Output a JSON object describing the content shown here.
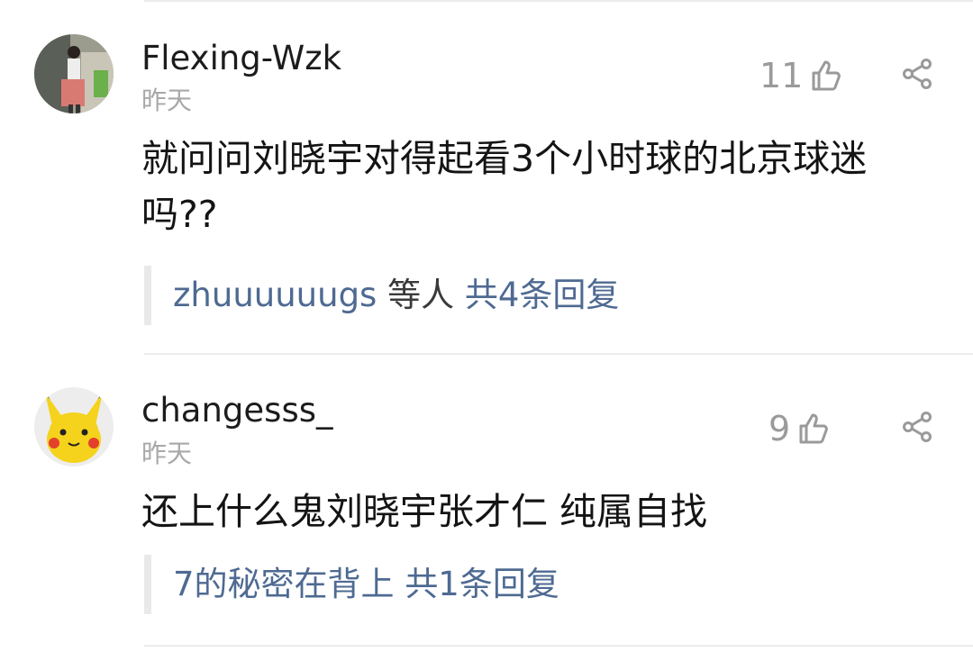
{
  "comments": [
    {
      "user": "Flexing-Wzk",
      "time": "昨天",
      "likes": "11",
      "text": "就问问刘晓宇对得起看3个小时球的北京球迷吗??",
      "reply_user": "zhuuuuuugs",
      "reply_mid": " 等人 ",
      "reply_count": "共4条回复",
      "avatar_icon": "user-photo-avatar"
    },
    {
      "user": "changesss_",
      "time": "昨天",
      "likes": "9",
      "text": "还上什么鬼刘晓宇张才仁 纯属自找",
      "reply_user": "7的秘密在背上",
      "reply_mid": " ",
      "reply_count": "共1条回复",
      "avatar_icon": "pikachu-avatar"
    }
  ],
  "colors": {
    "link": "#4e6a92",
    "muted": "#a8a8a8",
    "text": "#141414"
  }
}
